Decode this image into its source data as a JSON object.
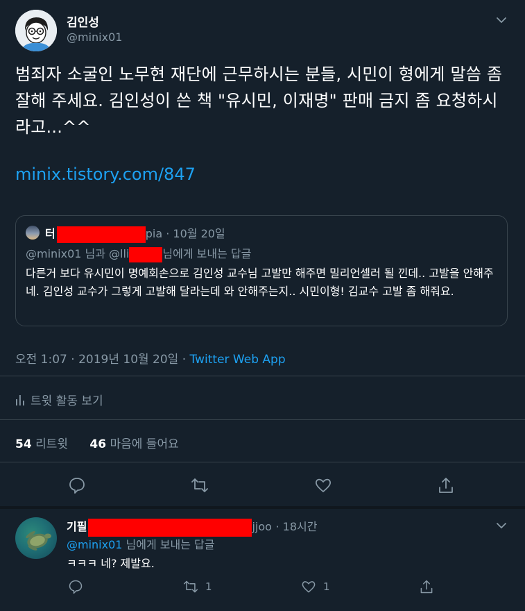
{
  "main_tweet": {
    "author_name": "김인성",
    "handle": "@minix01",
    "text": "범죄자 소굴인 노무현 재단에 근무하시는 분들, 시민이 형에게 말씀 좀 잘해 주세요. 김인성이 쓴 책 \"유시민, 이재명\" 판매 금지 좀 요청하시라고...^^",
    "link": "minix.tistory.com/847",
    "timestamp": "오전 1:07 · 2019년 10월 20일 · ",
    "source": "Twitter Web App",
    "activity_label": "트윗 활동 보기",
    "retweet_count": "54",
    "retweet_label": "리트윗",
    "like_count": "46",
    "like_label": "마음에 들어요"
  },
  "quoted_tweet": {
    "author_prefix": "터",
    "author_suffix": "pia",
    "date": "· 10월 20일",
    "reply_prefix": "@minix01 님과 @lli",
    "reply_suffix": "님에게 보내는 답글",
    "text": "다른거 보다 유시민이 명예회손으로 김인성 교수님 고발만 해주면 밀리언셀러 될 낀데.. 고발을 안해주네. 김인성 교수가 그렇게 고발해 달라는데 와 안해주는지.. 시민이형! 김교수 고발 좀 해줘요."
  },
  "reply_tweet": {
    "author_prefix": "기필",
    "author_suffix": "jjoo",
    "time": "· 18시간",
    "reply_to_handle": "@minix01",
    "reply_to_suffix": " 님에게 보내는 답글",
    "text": "ㅋㅋㅋ 네? 제발요.",
    "retweet_count": "1",
    "like_count": "1"
  },
  "icons": {
    "reply": "reply-icon",
    "retweet": "retweet-icon",
    "like": "heart-icon",
    "share": "share-icon",
    "activity": "bar-chart-icon",
    "menu": "chevron-down-icon"
  },
  "colors": {
    "background": "#15202b",
    "link": "#1da1f2",
    "muted": "#8899a6",
    "border": "#38444d",
    "redaction": "#ff0000"
  }
}
